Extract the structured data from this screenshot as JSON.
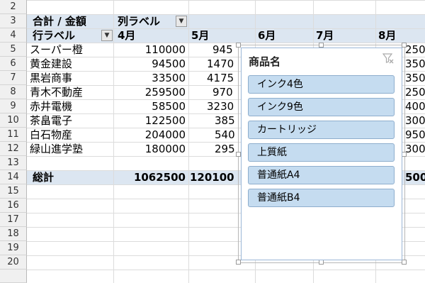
{
  "row_numbers": [
    "2",
    "3",
    "4",
    "5",
    "6",
    "7",
    "8",
    "9",
    "10",
    "11",
    "12",
    "13",
    "14",
    "15",
    "16",
    "17",
    "18",
    "19",
    "20"
  ],
  "pivot": {
    "corner_label": "合計 / 金額",
    "col_label": "列ラベル",
    "row_label": "行ラベル",
    "months": [
      "4月",
      "5月",
      "6月",
      "7月",
      "8月"
    ],
    "rows": [
      {
        "name": "スーパー橙",
        "apr": "110000",
        "may": "945"
      },
      {
        "name": "黄金建設",
        "apr": "94500",
        "may": "1470"
      },
      {
        "name": "黒岩商事",
        "apr": "33500",
        "may": "4175"
      },
      {
        "name": "青木不動産",
        "apr": "259500",
        "may": "970"
      },
      {
        "name": "赤井電機",
        "apr": "58500",
        "may": "3230"
      },
      {
        "name": "茶畠電子",
        "apr": "122500",
        "may": "385"
      },
      {
        "name": "白石物産",
        "apr": "204000",
        "may": "540"
      },
      {
        "name": "緑山進学塾",
        "apr": "180000",
        "may": "295"
      }
    ],
    "total_label": "総計",
    "total_apr": "1062500",
    "total_may": "120100",
    "right_edge": [
      "250",
      "350",
      "350",
      "250",
      "400",
      "300",
      "950",
      "300",
      "500"
    ]
  },
  "slicer": {
    "title": "商品名",
    "items": [
      "インク4色",
      "インク9色",
      "カートリッジ",
      "上質紙",
      "普通紙A4",
      "普通紙B4"
    ]
  },
  "icons": {
    "dropdown": "chevron-down-icon",
    "clear_filter": "clear-filter-icon"
  },
  "colors": {
    "header_band": "#dce6f1",
    "slicer_item": "#c5dcf0",
    "slicer_border": "#9bb6d6"
  }
}
